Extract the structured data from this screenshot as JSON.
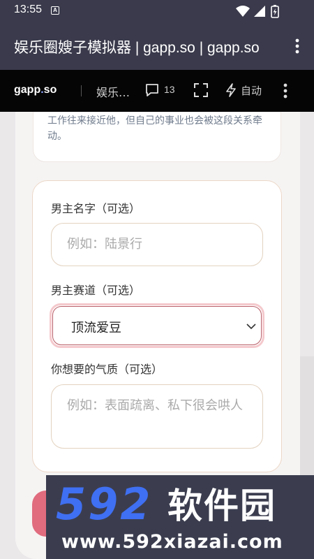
{
  "status_bar": {
    "time": "13:55",
    "notification_icon": "A"
  },
  "app_bar": {
    "title": "娱乐圈嫂子模拟器 | gapp.so | gapp.so"
  },
  "site_nav": {
    "logo_left": "gapp",
    "logo_dot": ".",
    "logo_right": "so",
    "page_title": "娱乐…",
    "comment_count": "13",
    "auto_label": "自动"
  },
  "top_card": {
    "text": "工作往来接近他，但自己的事业也会被这段关系牵动。"
  },
  "form": {
    "male_name_label": "男主名字（可选）",
    "male_name_placeholder": "例如：陆景行",
    "track_label": "男主赛道（可选）",
    "track_value": "顶流爱豆",
    "temperament_label": "你想要的气质（可选）",
    "temperament_placeholder": "例如：表面疏离、私下很会哄人"
  },
  "watermark": {
    "logo": "592",
    "brand": "软件园",
    "url": "www.592xiazai.com"
  },
  "colors": {
    "system_bar": "#3a3a4c",
    "nav_bg": "#050505",
    "accent_pink": "#e06c7e",
    "watermark_blue": "#3f6ff2"
  }
}
